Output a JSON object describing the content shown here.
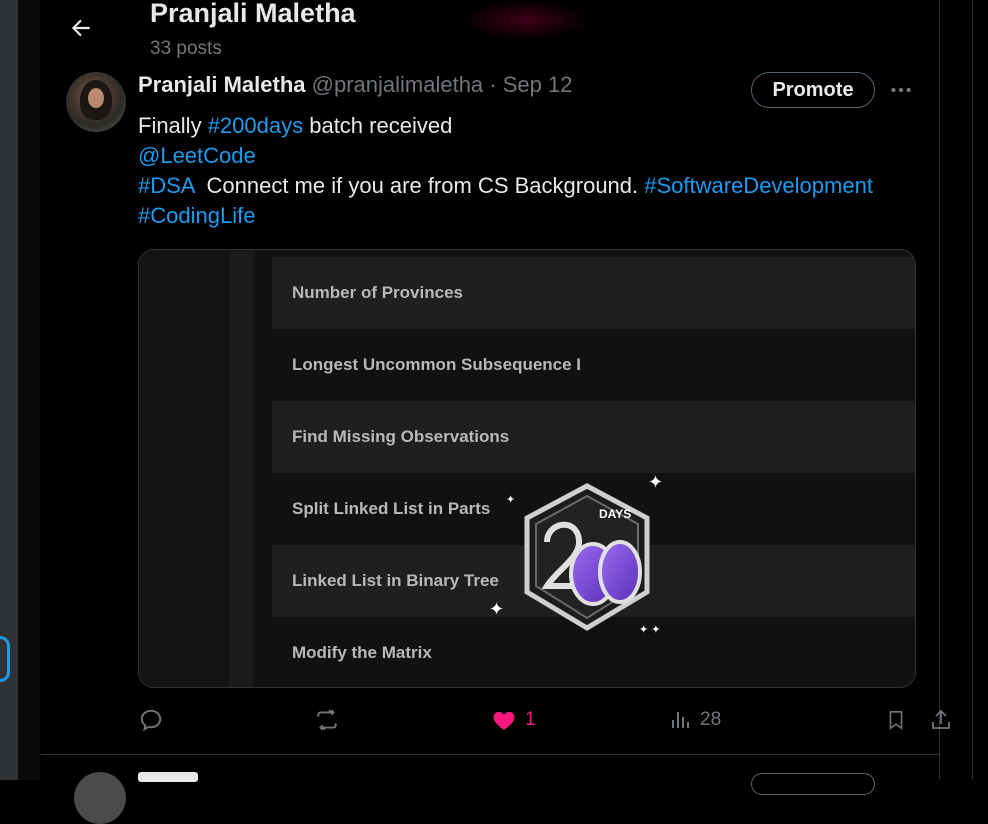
{
  "header": {
    "name": "Pranjali Maletha",
    "post_count": "33 posts"
  },
  "tweet": {
    "author_name": "Pranjali Maletha",
    "meta": "@pranjalimaletha · Sep 12",
    "promote_label": "Promote",
    "text": {
      "line1_pre": "Finally ",
      "hashtag_200days": "#200days",
      "line1_post": " batch received",
      "mention": "@LeetCode",
      "hashtag_dsa": "#DSA",
      "line3_mid": "  Connect me if you are from CS Background. ",
      "hashtag_softdev": "#SoftwareDevelopment",
      "hashtag_codinglife": "#CodingLife"
    },
    "image_rows": [
      "Number of Provinces",
      "Longest Uncommon Subsequence I",
      "Find Missing Observations",
      "Split Linked List in Parts",
      "Linked List in Binary Tree",
      "Modify the Matrix"
    ],
    "badge_label": "DAYS",
    "actions": {
      "likes": "1",
      "views": "28"
    },
    "colors": {
      "link": "#1d9bf0",
      "like": "#f91880",
      "badge_purple": "#7b4fd9"
    }
  }
}
